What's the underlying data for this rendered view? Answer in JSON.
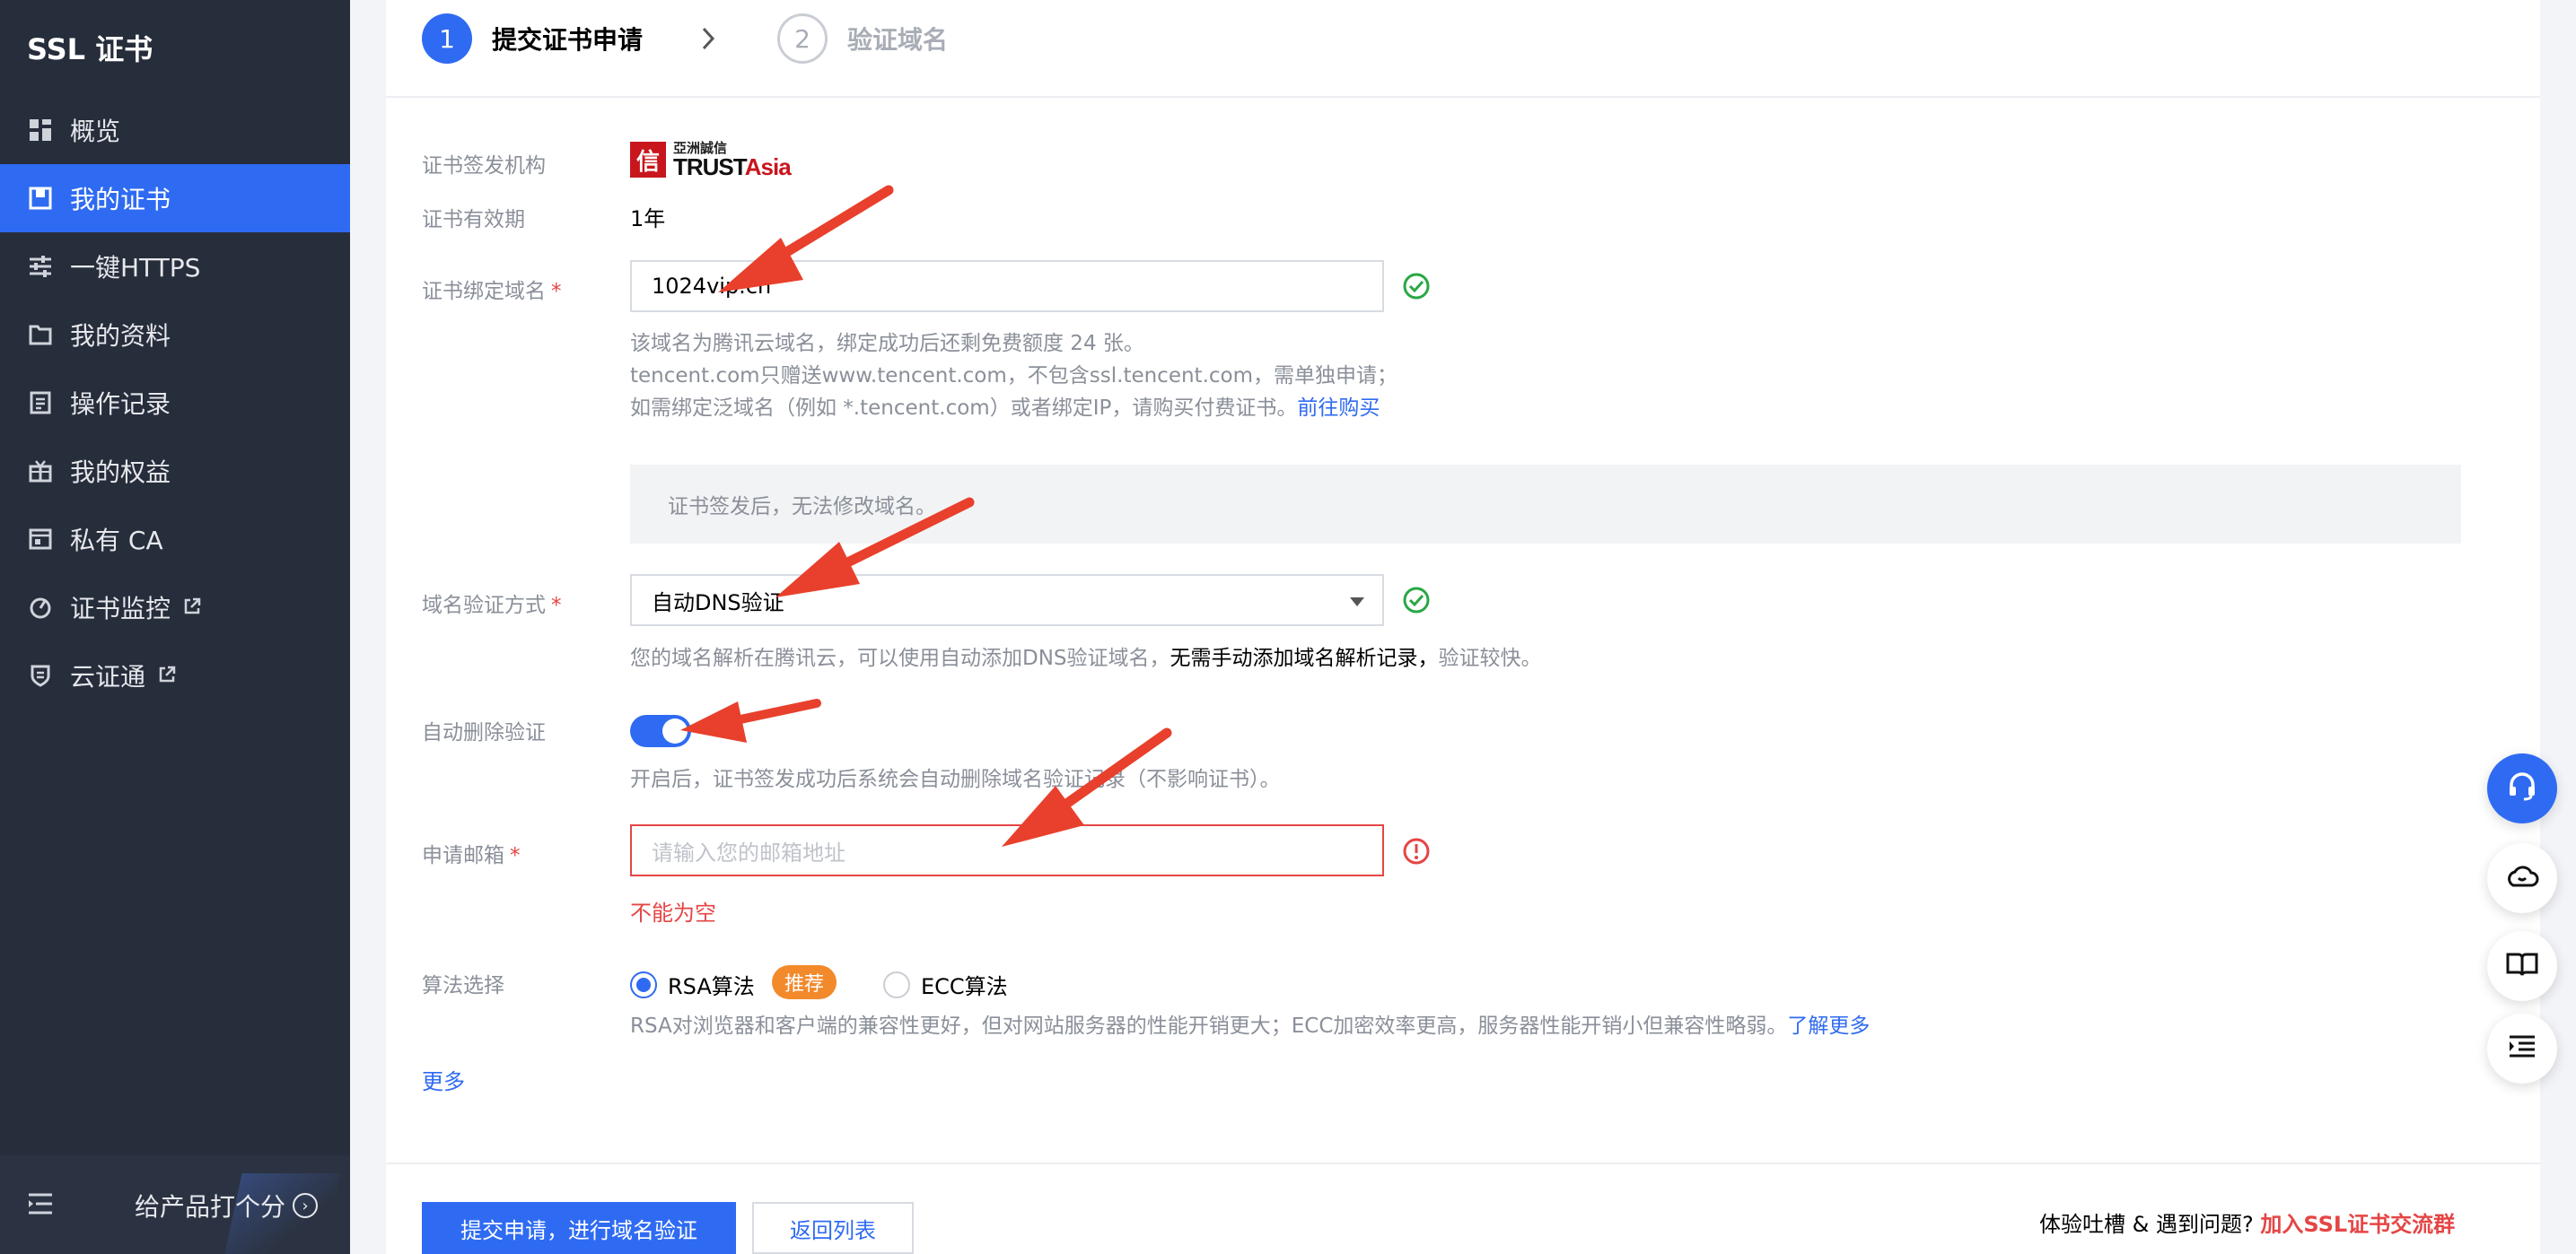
{
  "sidebar": {
    "title": "SSL 证书",
    "items": [
      {
        "label": "概览",
        "icon": "dashboard-icon"
      },
      {
        "label": "我的证书",
        "icon": "certificate-icon",
        "active": true
      },
      {
        "label": "一键HTTPS",
        "icon": "sliders-icon"
      },
      {
        "label": "我的资料",
        "icon": "folder-icon"
      },
      {
        "label": "操作记录",
        "icon": "log-icon"
      },
      {
        "label": "我的权益",
        "icon": "gift-icon"
      },
      {
        "label": "私有 CA",
        "icon": "ca-icon"
      },
      {
        "label": "证书监控",
        "icon": "monitor-icon",
        "external": true
      },
      {
        "label": "云证通",
        "icon": "shield-icon",
        "external": true
      }
    ],
    "footer_rate": "给产品打个分"
  },
  "steps": [
    {
      "num": "1",
      "label": "提交证书申请"
    },
    {
      "num": "2",
      "label": "验证域名"
    }
  ],
  "form": {
    "issuer_label": "证书签发机构",
    "issuer_logo_cn": "亞洲誠信",
    "issuer_logo_en_black": "TRUST",
    "issuer_logo_en_red": "Asia",
    "validity_label": "证书有效期",
    "validity_value": "1年",
    "domain_label": "证书绑定域名",
    "domain_value": "1024vip.cn",
    "domain_help_1": "该域名为腾讯云域名，绑定成功后还剩免费额度 24 张。",
    "domain_help_2": "tencent.com只赠送www.tencent.com，不包含ssl.tencent.com，需单独申请；",
    "domain_help_3": "如需绑定泛域名（例如 *.tencent.com）或者绑定IP，请购买付费证书。",
    "domain_help_link": "前往购买",
    "notice": "证书签发后，无法修改域名。",
    "verify_label": "域名验证方式",
    "verify_value": "自动DNS验证",
    "verify_help_a": "您的域名解析在腾讯云，可以使用自动添加DNS验证域名，",
    "verify_help_strong": "无需手动添加域名解析记录，",
    "verify_help_b": "验证较快。",
    "autodel_label": "自动删除验证",
    "autodel_on": true,
    "autodel_help": "开启后，证书签发成功后系统会自动删除域名验证记录（不影响证书）。",
    "email_label": "申请邮箱",
    "email_placeholder": "请输入您的邮箱地址",
    "email_error": "不能为空",
    "algo_label": "算法选择",
    "algo_rsa": "RSA算法",
    "algo_badge": "推荐",
    "algo_ecc": "ECC算法",
    "algo_help": "RSA对浏览器和客户端的兼容性更好，但对网站服务器的性能开销更大；ECC加密效率更高，服务器性能开销小但兼容性略弱。",
    "algo_help_link": "了解更多",
    "more": "更多"
  },
  "footer": {
    "submit": "提交申请，进行域名验证",
    "back": "返回列表",
    "feedback_prefix": "体验吐槽 & 遇到问题?",
    "feedback_link": "加入SSL证书交流群"
  },
  "colors": {
    "accent": "#2f6bf2",
    "sidebar_bg": "#262d3b",
    "error": "#e54545",
    "success": "#29a744",
    "badge": "#f28a2c",
    "annotation_arrow": "#e8402c"
  }
}
